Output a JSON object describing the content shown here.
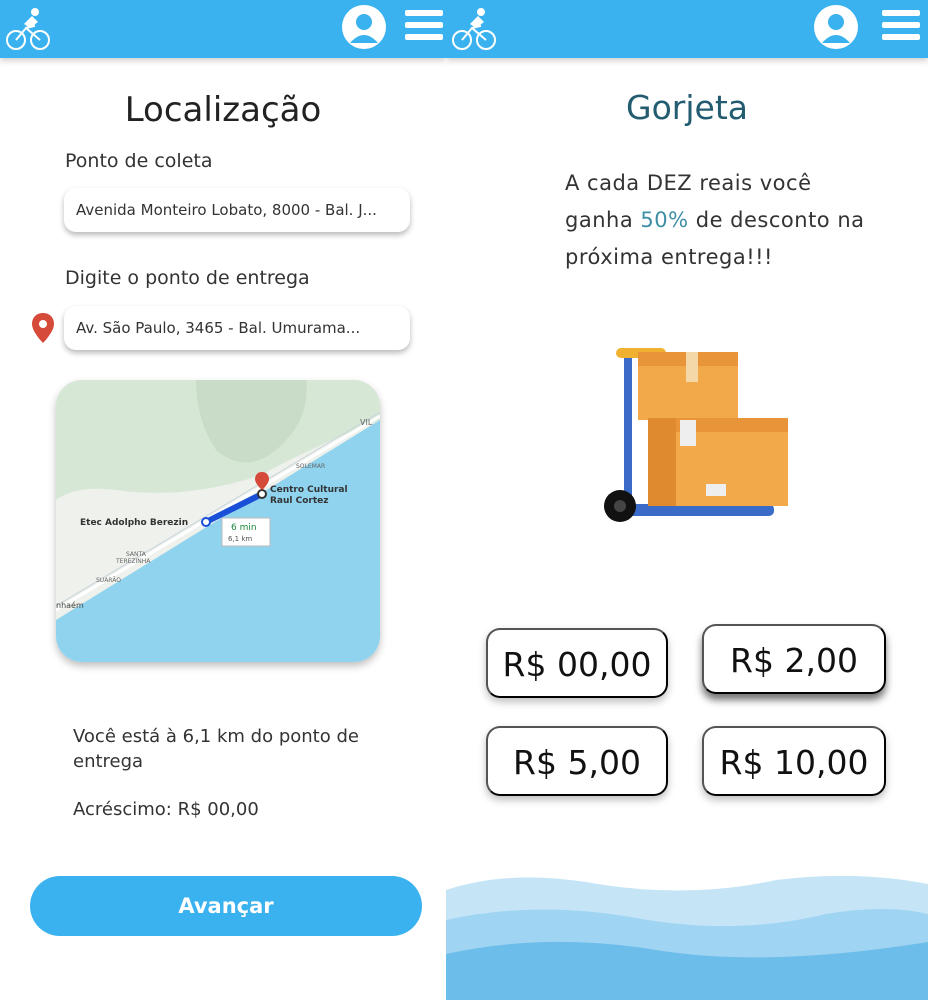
{
  "location_screen": {
    "title": "Localização",
    "pickup_label": "Ponto de coleta",
    "pickup_value": "Avenida Monteiro Lobato, 8000 - Bal. J...",
    "delivery_label": "Digite o ponto de entrega",
    "delivery_value": "Av. São Paulo, 3465 - Bal. Umurama...",
    "map": {
      "labels": {
        "origin": "Etec Adolpho Berezin",
        "destination_line1": "Centro Cultural",
        "destination_line2": "Raul Cortez",
        "duration": "6 min",
        "distance": "6,1 km",
        "area_1": "SANTA",
        "area_1b": "TEREZINHA",
        "area_2": "SUARÃO",
        "area_3": "SOLEMAR",
        "area_4": "VIL",
        "area_5": "nhaém"
      }
    },
    "distance_text": "Você está à 6,1 km do ponto de entrega",
    "surcharge_text": "Acréscimo: R$ 00,00",
    "next_button": "Avançar"
  },
  "tip_screen": {
    "title": "Gorjeta",
    "promo_part1": "A cada DEZ reais você ganha",
    "promo_highlight": "50%",
    "promo_part2": "de desconto na próxima entrega!!!",
    "options": [
      "R$ 00,00",
      "R$ 2,00",
      "R$ 5,00",
      "R$ 10,00"
    ],
    "selected_option": "R$ 2,00"
  },
  "icons": {
    "logo": "cyclist-icon",
    "profile": "user-avatar-icon",
    "menu": "hamburger-menu-icon",
    "location": "location-pin-icon",
    "illustration": "hand-truck-boxes-illustration"
  },
  "colors": {
    "primary": "#3ab2ef",
    "title_teal": "#235c70",
    "highlight": "#3e8fa6",
    "pin_red": "#d64a3a",
    "sea": "#8fd3ef",
    "route": "#1a4fd8"
  }
}
